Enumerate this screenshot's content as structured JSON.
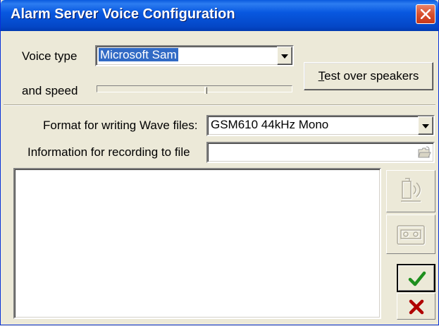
{
  "window": {
    "title": "Alarm Server Voice Configuration"
  },
  "voice": {
    "type_label": "Voice type",
    "type_value": "Microsoft Sam",
    "speed_label": "and speed",
    "speed_level": 0.56
  },
  "test_button": {
    "mnemonic": "T",
    "rest": "est over speakers"
  },
  "wave_format": {
    "label": "Format for writing Wave files:",
    "value": "GSM610 44kHz Mono"
  },
  "recording": {
    "label": "Information for recording to file",
    "value": ""
  },
  "side_buttons": {
    "speak_icon": "speaker-disabled-icon",
    "tape_icon": "tape-disabled-icon",
    "ok_icon": "checkmark-icon",
    "cancel_icon": "red-x-icon"
  },
  "colors": {
    "title_bar": "#0554d8",
    "selection": "#316ac5",
    "ok_green": "#1e8f1e",
    "cancel_red": "#b00000"
  }
}
